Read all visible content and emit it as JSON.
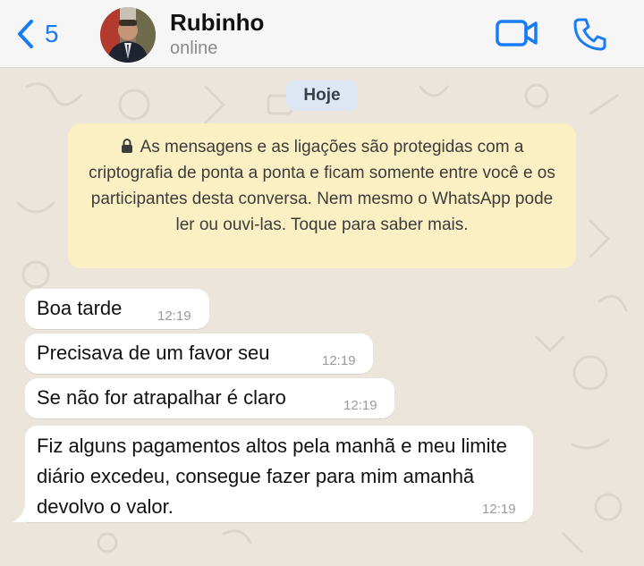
{
  "header": {
    "back_count": "5",
    "contact_name": "Rubinho",
    "status": "online"
  },
  "chat": {
    "date_label": "Hoje",
    "encryption_notice": "As mensagens e as ligações são protegidas com a criptografia de ponta a ponta e ficam somente entre você e os participantes desta conversa. Nem mesmo o WhatsApp pode ler ou ouvi-las. Toque para saber mais.",
    "messages": [
      {
        "text": "Boa tarde",
        "time": "12:19"
      },
      {
        "text": "Precisava de um favor seu",
        "time": "12:19"
      },
      {
        "text": "Se não for atrapalhar é claro",
        "time": "12:19"
      },
      {
        "text": "Fiz alguns pagamentos altos pela manhã e meu limite diário excedeu, consegue fazer para mim amanhã devolvo o valor.",
        "time": "12:19"
      }
    ]
  },
  "colors": {
    "accent": "#1a7cf5",
    "notice_bg": "#fbf0c3",
    "chat_bg": "#ebe5dc",
    "bubble_bg": "#ffffff"
  },
  "icons": [
    "chevron-left-icon",
    "video-camera-icon",
    "phone-icon",
    "lock-icon"
  ]
}
